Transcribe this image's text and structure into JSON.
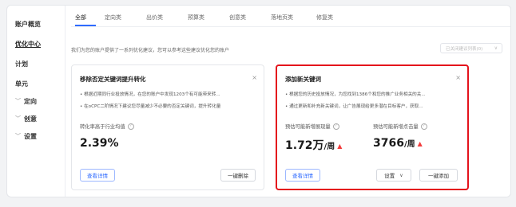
{
  "sidebar": {
    "items": [
      {
        "label": "账户概览",
        "chevron": ""
      },
      {
        "label": "优化中心",
        "chevron": ""
      },
      {
        "label": "计划",
        "chevron": ""
      },
      {
        "label": "单元",
        "chevron": ""
      },
      {
        "label": "定向",
        "chevron": "﹀"
      },
      {
        "label": "创意",
        "chevron": "﹀"
      },
      {
        "label": "设置",
        "chevron": "﹀"
      }
    ]
  },
  "tabs": [
    "全部",
    "定向类",
    "出价类",
    "预算类",
    "创意类",
    "落地页类",
    "修复类"
  ],
  "description": "我们为您的账户提供了一系列优化建议，您可以参考这些建议优化您的账户",
  "filter": {
    "label": "已关闭建议列表(0)"
  },
  "cards": [
    {
      "title": "移除否定关键词提升转化",
      "bullets": [
        "• 根据近期同行业投放情况，在您的账户中发现1203个有可能带来转...",
        "• 在oCPC二阶情况下建议您尽量减少不必要的否定关键词，提升转化量"
      ],
      "metric_label": "转化率高于行业均值",
      "metric_value": "2.39%",
      "buttons": {
        "detail": "查看详情",
        "action": "一键删除"
      }
    },
    {
      "title": "添加新关键词",
      "bullets": [
        "• 根据您的历史投放情况，为您找到1386个和您的推广业务相关的关...",
        "• 通过更新和补充新关键词，让广告展现给更多潜在目标客户，获取..."
      ],
      "metrics": [
        {
          "label": "预估可能新增展现量",
          "value": "1.72万",
          "unit": "/周"
        },
        {
          "label": "预估可能新增点击量",
          "value": "3766",
          "unit": "/周"
        }
      ],
      "buttons": {
        "detail": "查看详情",
        "settings": "设置",
        "action": "一键添加"
      }
    }
  ],
  "icons": {
    "close": "×",
    "question": "?",
    "chevron_down": "∨",
    "up_arrow": "▲"
  },
  "colors": {
    "accent": "#2f6bff",
    "highlight_border": "#e4131c",
    "up_arrow": "#f23d3d"
  }
}
